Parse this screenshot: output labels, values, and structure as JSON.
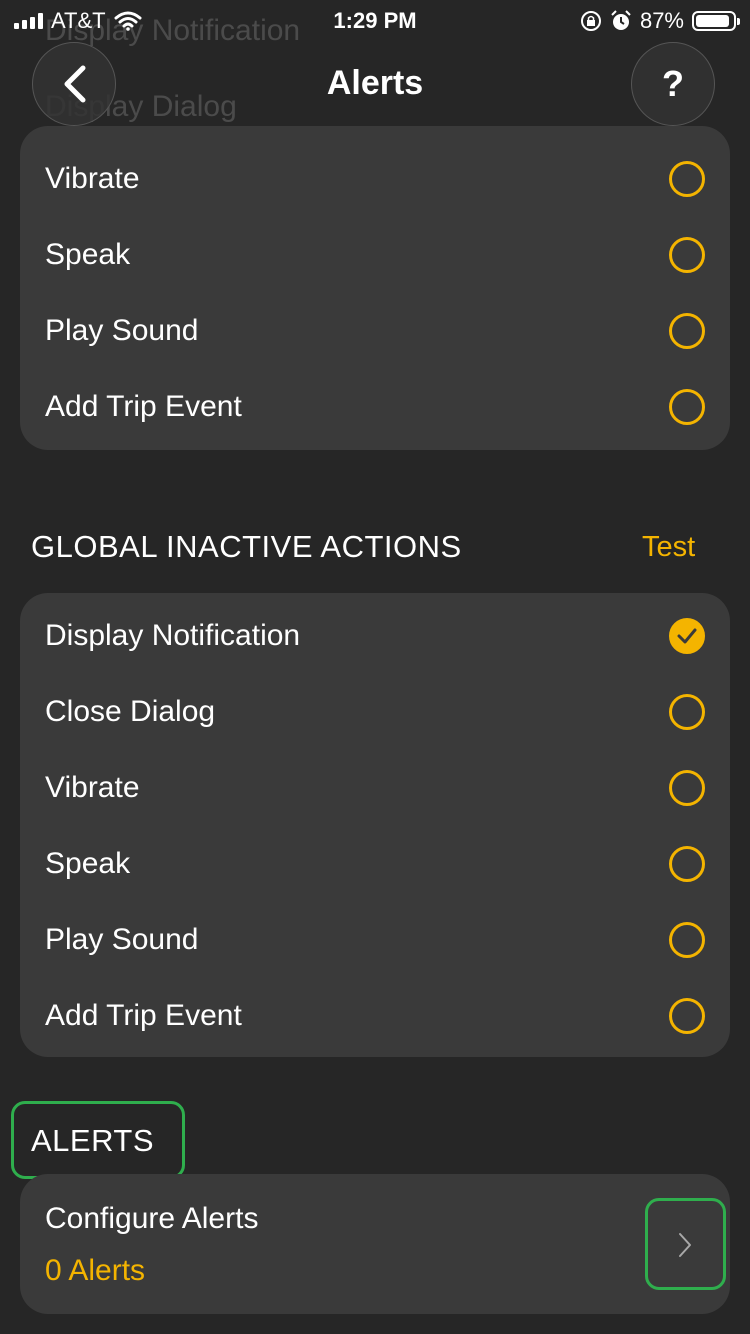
{
  "status_bar": {
    "carrier": "AT&T",
    "time": "1:29 PM",
    "battery": "87%"
  },
  "nav": {
    "title": "Alerts",
    "help_label": "?"
  },
  "scrolled_behind": [
    "Display Notification",
    "Display Dialog"
  ],
  "top_section": {
    "rows": [
      {
        "label": "Vibrate",
        "checked": false
      },
      {
        "label": "Speak",
        "checked": false
      },
      {
        "label": "Play Sound",
        "checked": false
      },
      {
        "label": "Add Trip Event",
        "checked": false
      }
    ]
  },
  "inactive_section": {
    "header": "GLOBAL INACTIVE ACTIONS",
    "test_label": "Test",
    "rows": [
      {
        "label": "Display Notification",
        "checked": true
      },
      {
        "label": "Close Dialog",
        "checked": false
      },
      {
        "label": "Vibrate",
        "checked": false
      },
      {
        "label": "Speak",
        "checked": false
      },
      {
        "label": "Play Sound",
        "checked": false
      },
      {
        "label": "Add Trip Event",
        "checked": false
      }
    ]
  },
  "alerts_section": {
    "header": "ALERTS",
    "configure_label": "Configure Alerts",
    "count_label": "0 Alerts"
  },
  "colors": {
    "accent": "#f4b400",
    "background": "#262626",
    "card": "#3a3a3a",
    "highlight": "#2fae4d"
  }
}
